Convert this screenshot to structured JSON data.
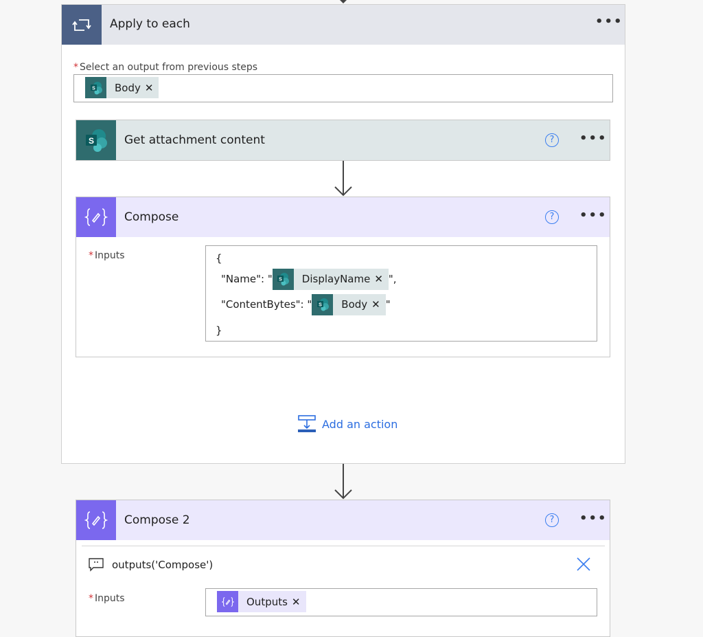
{
  "apply_to_each": {
    "title": "Apply to each",
    "more_label": "•••",
    "select_label": "Select an output from previous steps",
    "required_mark": "*",
    "selected_token": {
      "label": "Body",
      "remove": "✕",
      "source": "sharepoint"
    }
  },
  "actions": {
    "get_attachment": {
      "title": "Get attachment content",
      "help": "?",
      "more_label": "•••"
    },
    "compose": {
      "title": "Compose",
      "help": "?",
      "more_label": "•••",
      "inputs_label": "Inputs",
      "required_mark": "*",
      "json": {
        "open_brace": "{",
        "name_key": "\"Name\": \"",
        "name_token": "DisplayName",
        "name_suffix": "\",",
        "content_key": "\"ContentBytes\": \"",
        "content_token": "Body",
        "content_suffix": "\"",
        "close_brace": "}",
        "remove": "✕"
      }
    },
    "add_action_label": "Add an action",
    "compose2": {
      "title": "Compose 2",
      "help": "?",
      "more_label": "•••",
      "expression": "outputs('Compose')",
      "inputs_label": "Inputs",
      "required_mark": "*",
      "input_token": {
        "label": "Outputs",
        "remove": "✕",
        "source": "compose"
      }
    }
  },
  "colors": {
    "loop_accent": "#4b6086",
    "sharepoint_accent": "#2f6c6e",
    "compose_accent": "#7b68ee",
    "link_blue": "#2b6de0",
    "required_red": "#d13438"
  }
}
